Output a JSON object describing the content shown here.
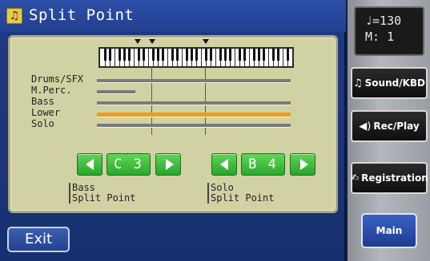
{
  "title": {
    "text": "Split Point",
    "icon": "music-note-icon"
  },
  "parts": [
    {
      "label": "Drums/SFX",
      "active": false
    },
    {
      "label": "M.Perc.",
      "active": false
    },
    {
      "label": "Bass",
      "active": false
    },
    {
      "label": "Lower",
      "active": true
    },
    {
      "label": "Solo",
      "active": false
    }
  ],
  "bass_split": {
    "value": "C 3",
    "caption_line1": "Bass",
    "caption_line2": "Split Point"
  },
  "solo_split": {
    "value": "B 4",
    "caption_line1": "Solo",
    "caption_line2": "Split Point"
  },
  "exit_label": "Exit",
  "tempo": {
    "line1": "♩=130",
    "line2": "M:   1"
  },
  "side_buttons": [
    {
      "label": "Sound/KBD",
      "icon": "music-note-icon"
    },
    {
      "label": "Rec/Play",
      "icon": "speaker-icon"
    },
    {
      "label": "Registration",
      "icon": "registration-icon"
    }
  ],
  "main_label": "Main",
  "colors": {
    "active_part": "#f39a1a",
    "arrow_green": "#2aa82c",
    "screen_blue": "#1f3a86"
  }
}
